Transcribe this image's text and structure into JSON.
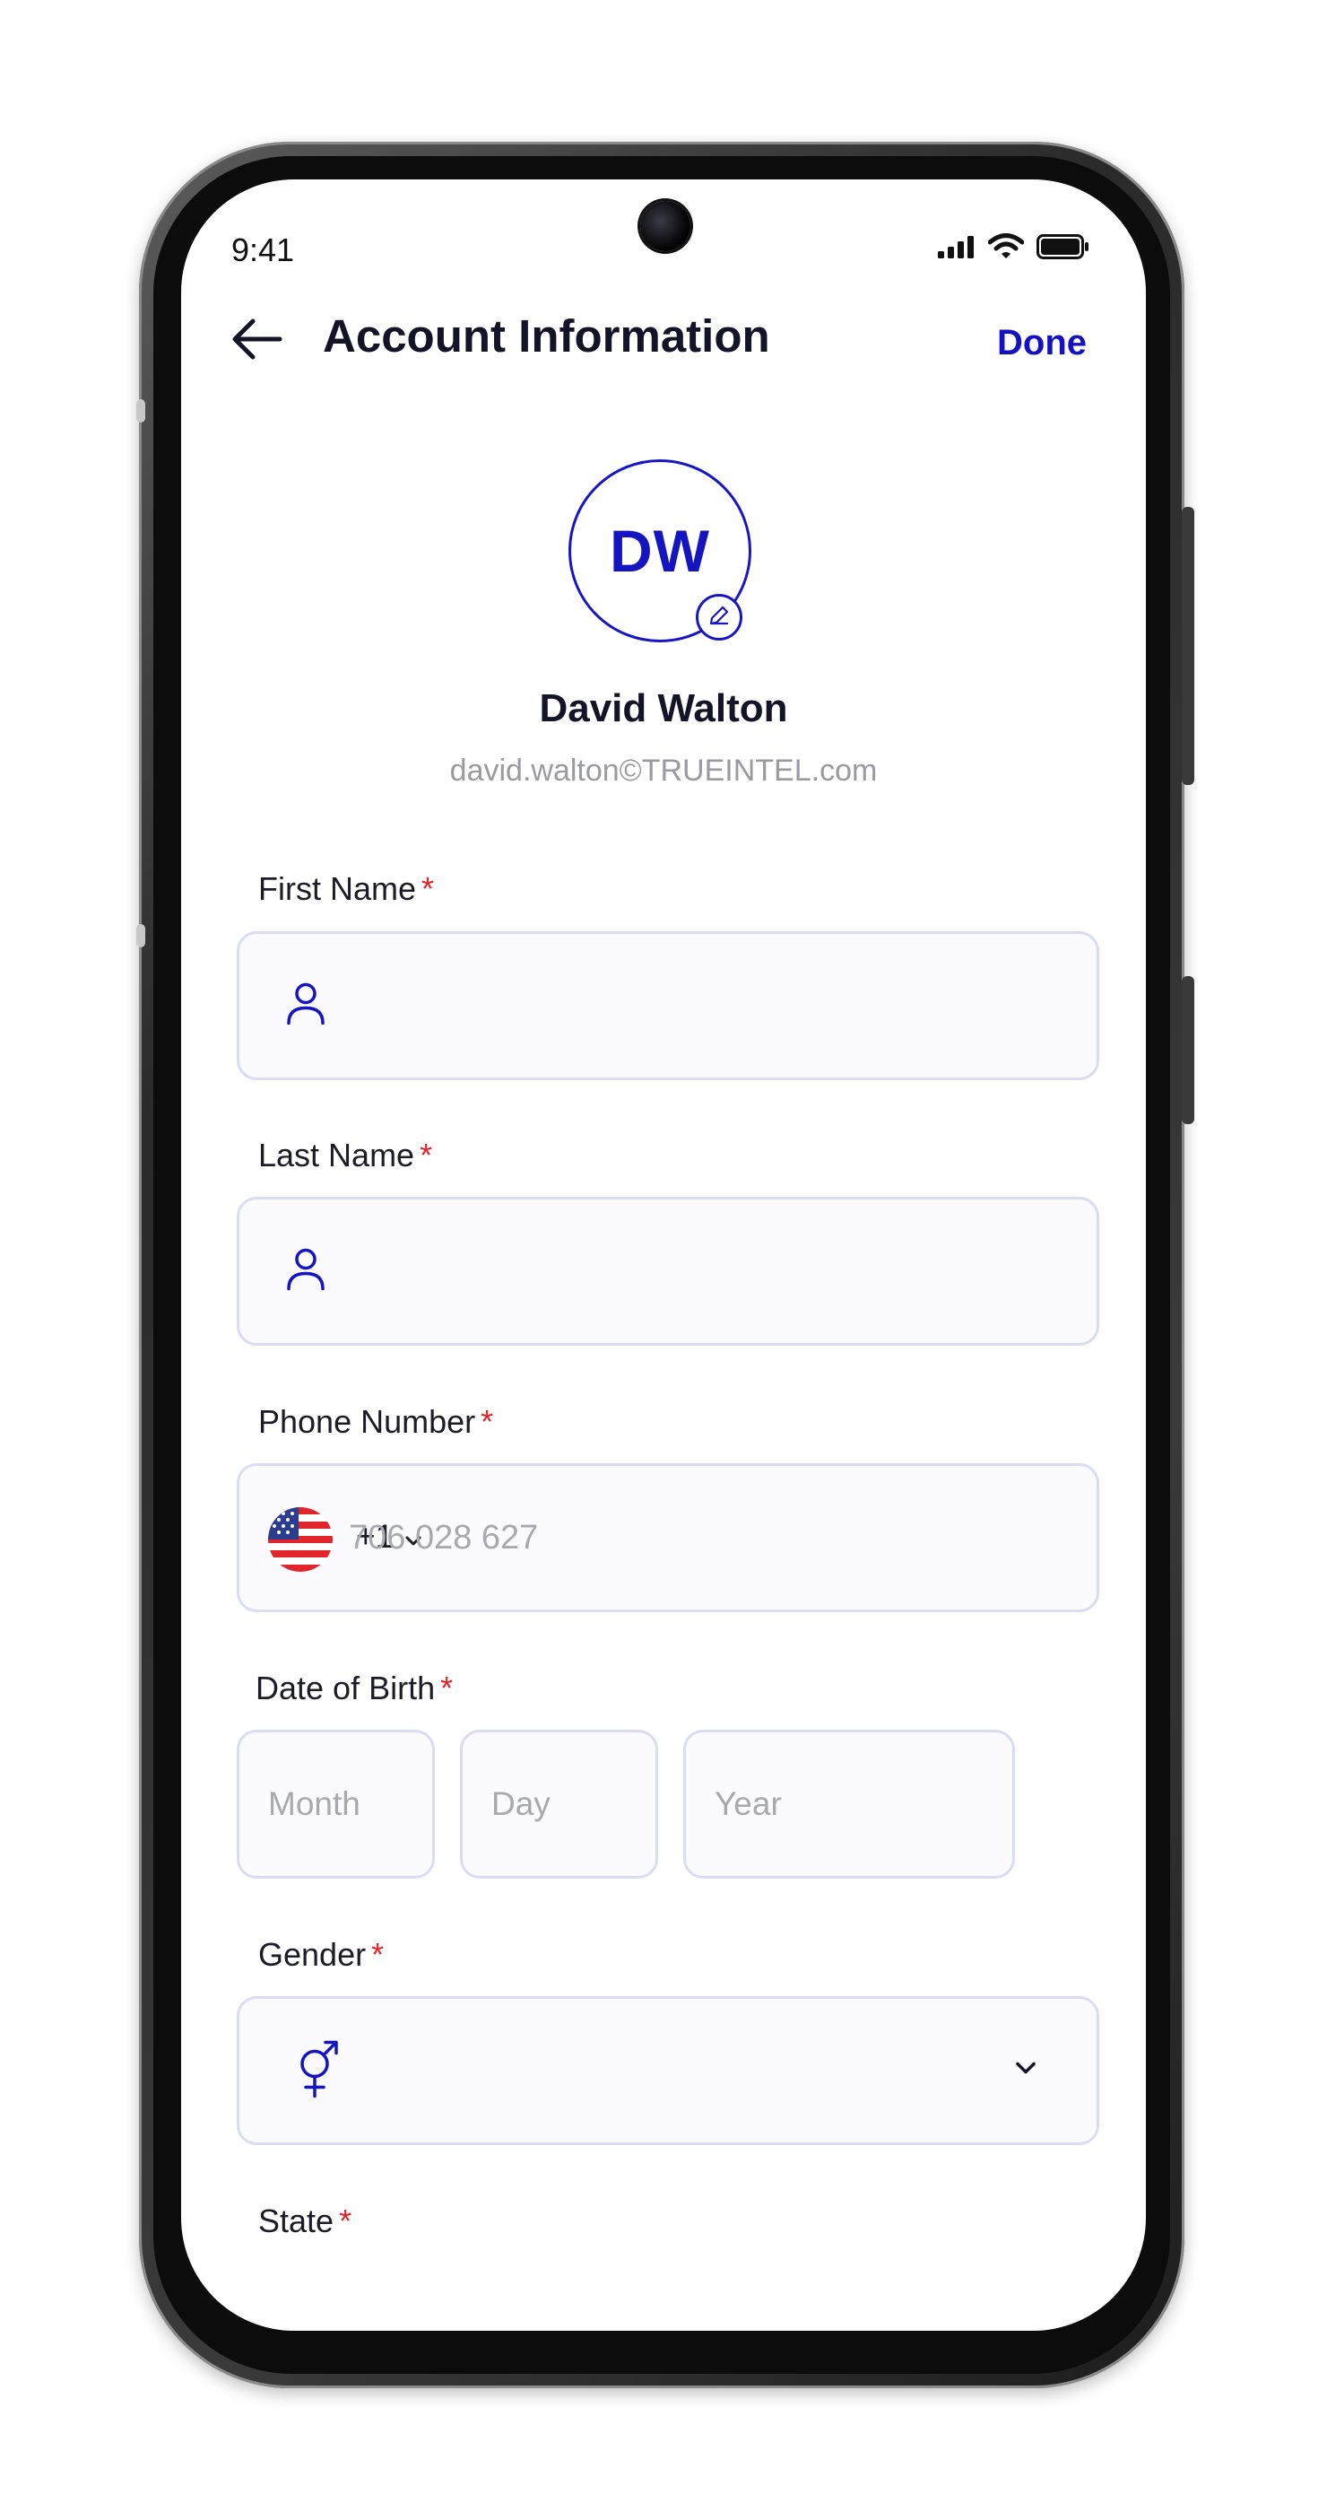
{
  "status_bar": {
    "time": "9:41"
  },
  "header": {
    "title": "Account Information",
    "done_label": "Done"
  },
  "profile": {
    "initials": "DW",
    "name": "David Walton",
    "email": "david.walton©TRUEINTEL.com"
  },
  "form": {
    "required_marker": "*",
    "first_name": {
      "label": "First Name",
      "value": ""
    },
    "last_name": {
      "label": "Last Name",
      "value": ""
    },
    "phone": {
      "label": "Phone Number",
      "country_code": "+1",
      "placeholder": "706 028 627",
      "value": ""
    },
    "dob": {
      "label": "Date of Birth",
      "month_placeholder": "Month",
      "day_placeholder": "Day",
      "year_placeholder": "Year"
    },
    "gender": {
      "label": "Gender",
      "value": ""
    },
    "state": {
      "label": "State"
    }
  },
  "colors": {
    "accent": "#1414c0",
    "required": "#e0252b",
    "field_bg": "#fafaff",
    "field_border": "#dadcf6"
  }
}
